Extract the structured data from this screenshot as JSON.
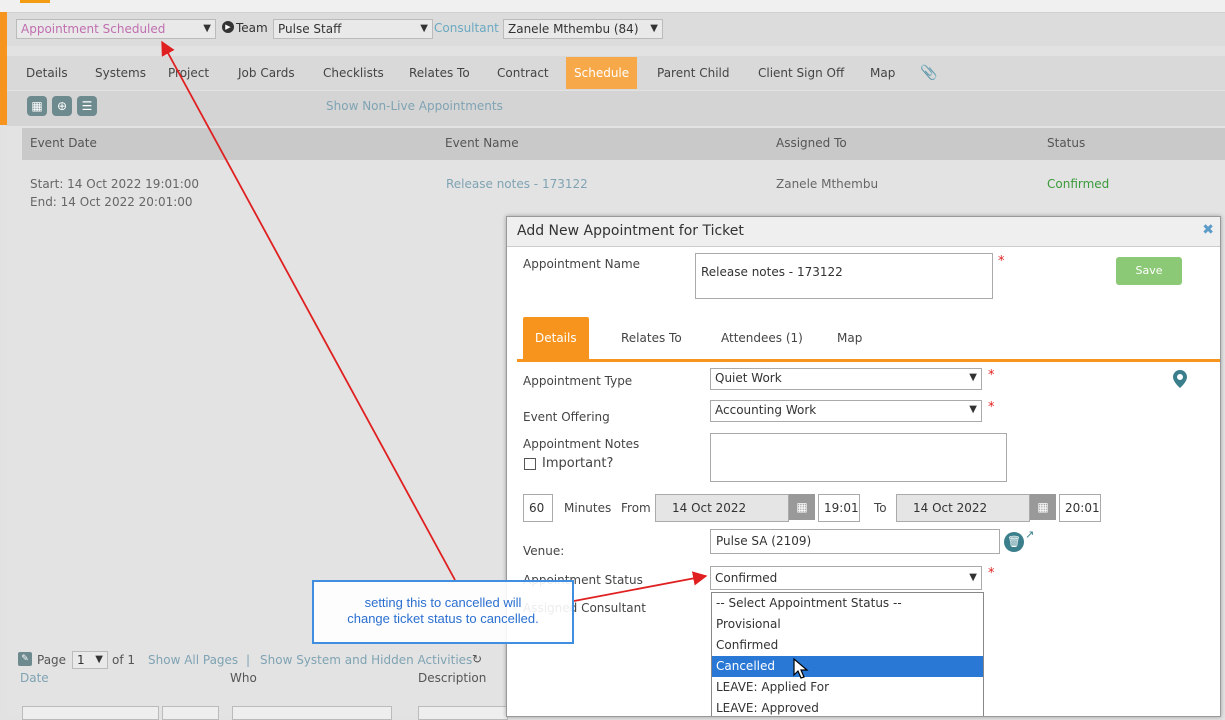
{
  "header": {
    "status_select": "Appointment Scheduled",
    "team_label": "Team",
    "team_select": "Pulse Staff",
    "consultant_label": "Consultant",
    "consultant_select": "Zanele Mthembu (84)"
  },
  "tabs": [
    "Details",
    "Systems",
    "Project",
    "Job Cards",
    "Checklists",
    "Relates To",
    "Contract",
    "Schedule",
    "Parent Child",
    "Client Sign Off",
    "Map"
  ],
  "toolbar": {
    "show_non_live": "Show Non-Live Appointments"
  },
  "grid": {
    "columns": [
      "Event Date",
      "Event Name",
      "Assigned To",
      "Status"
    ],
    "row": {
      "start": "Start: 14 Oct 2022 19:01:00",
      "end": "End: 14 Oct 2022 20:01:00",
      "event_name": "Release notes - 173122",
      "assigned_to": "Zanele Mthembu",
      "status": "Confirmed"
    }
  },
  "bottom": {
    "page_label": "Page",
    "page_value": "1",
    "of_label": "of 1",
    "show_all": "Show All Pages",
    "sep": "|",
    "show_system": "Show System and Hidden Activities",
    "col_date": "Date",
    "col_who": "Who",
    "col_desc": "Description"
  },
  "modal": {
    "title": "Add New Appointment for Ticket",
    "appointment_name_label": "Appointment Name",
    "appointment_name_value": "Release notes - 173122",
    "save_label": "Save",
    "tabs": [
      "Details",
      "Relates To",
      "Attendees (1)",
      "Map"
    ],
    "appointment_type_label": "Appointment Type",
    "appointment_type_value": "Quiet Work",
    "event_offering_label": "Event Offering",
    "event_offering_value": "Accounting Work",
    "notes_label": "Appointment Notes",
    "important_label": "Important?",
    "minutes_value": "60",
    "minutes_label": "Minutes",
    "from_label": "From",
    "from_date": "14 Oct 2022",
    "from_time": "19:01",
    "to_label": "To",
    "to_date": "14 Oct 2022",
    "to_time": "20:01",
    "venue_label": "Venue:",
    "venue_value": "Pulse SA (2109)",
    "status_label": "Appointment Status",
    "status_value": "Confirmed",
    "consultant_label": "Assigned Consultant",
    "required_mark": "*"
  },
  "status_options": [
    "-- Select Appointment Status --",
    "Provisional",
    "Confirmed",
    "Cancelled",
    "LEAVE: Applied For",
    "LEAVE: Approved"
  ],
  "annotation": {
    "line1": "setting this to cancelled will",
    "line2": "change ticket status to cancelled."
  },
  "colors": {
    "accent": "#f7941d",
    "arrow": "#e02020",
    "highlight": "#2a78d6"
  }
}
